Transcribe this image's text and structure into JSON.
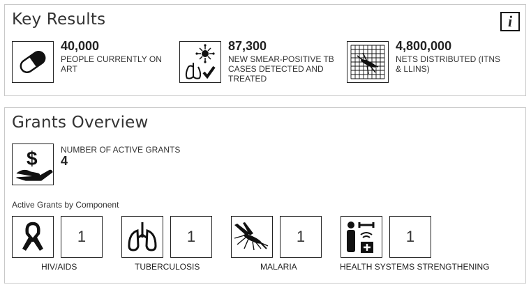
{
  "key_results": {
    "title": "Key Results",
    "info_icon": "info-icon",
    "items": [
      {
        "icon": "pill-icon",
        "value": "40,000",
        "label": "PEOPLE CURRENTLY ON ART"
      },
      {
        "icon": "tb-lungs-icon",
        "value": "87,300",
        "label": "NEW SMEAR-POSITIVE TB CASES DETECTED AND TREATED"
      },
      {
        "icon": "mosquito-net-icon",
        "value": "4,800,000",
        "label": "NETS DISTRIBUTED (ITNS & LLINS)"
      }
    ]
  },
  "grants_overview": {
    "title": "Grants Overview",
    "active_grants": {
      "icon": "money-hand-icon",
      "label": "NUMBER OF ACTIVE GRANTS",
      "value": "4"
    },
    "by_component_label": "Active Grants by Component",
    "components": [
      {
        "icon": "ribbon-icon",
        "count": "1",
        "label": "HIV/AIDS"
      },
      {
        "icon": "lungs-icon",
        "count": "1",
        "label": "TUBERCULOSIS"
      },
      {
        "icon": "mosquito-icon",
        "count": "1",
        "label": "MALARIA"
      },
      {
        "icon": "health-systems-icon",
        "count": "1",
        "label": "HEALTH SYSTEMS STRENGTHENING"
      }
    ]
  }
}
